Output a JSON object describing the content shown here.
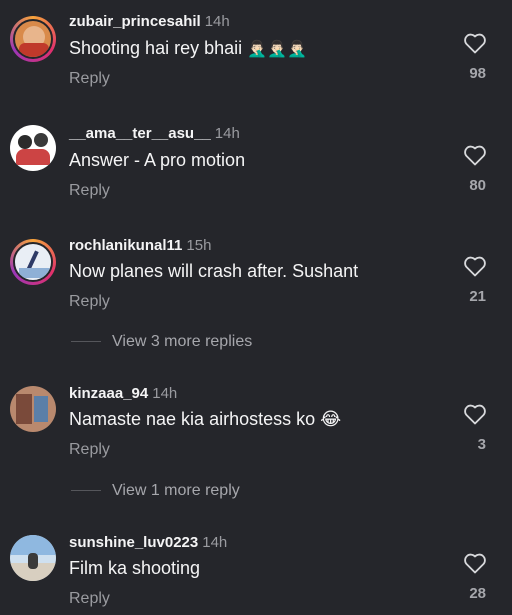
{
  "comments": [
    {
      "username": "zubair_princesahil",
      "time": "14h",
      "text": "Shooting hai rey bhaii",
      "emoji": "🤦🏻‍♂️🤦🏻‍♂️🤦🏻‍♂️",
      "reply": "Reply",
      "likes": "98"
    },
    {
      "username": "__ama__ter__asu__",
      "time": "14h",
      "text": "Answer - A pro motion",
      "reply": "Reply",
      "likes": "80"
    },
    {
      "username": "rochlanikunal11",
      "time": "15h",
      "text": "Now planes will crash after. Sushant",
      "reply": "Reply",
      "likes": "21"
    },
    {
      "username": "kinzaaa_94",
      "time": "14h",
      "text": "Namaste nae kia airhostess ko",
      "emoji": "😂",
      "reply": "Reply",
      "likes": "3"
    },
    {
      "username": "sunshine_luv0223",
      "time": "14h",
      "text": "Film ka shooting",
      "reply": "Reply",
      "likes": "28"
    }
  ],
  "more_replies": [
    {
      "label": "View 3 more replies"
    },
    {
      "label": "View 1 more reply"
    }
  ],
  "colors": {
    "background": "#25262b",
    "secondary_text": "#9a9ba0",
    "story_ring": "#e1306c"
  },
  "icons": {
    "like": "heart-outline-icon"
  }
}
